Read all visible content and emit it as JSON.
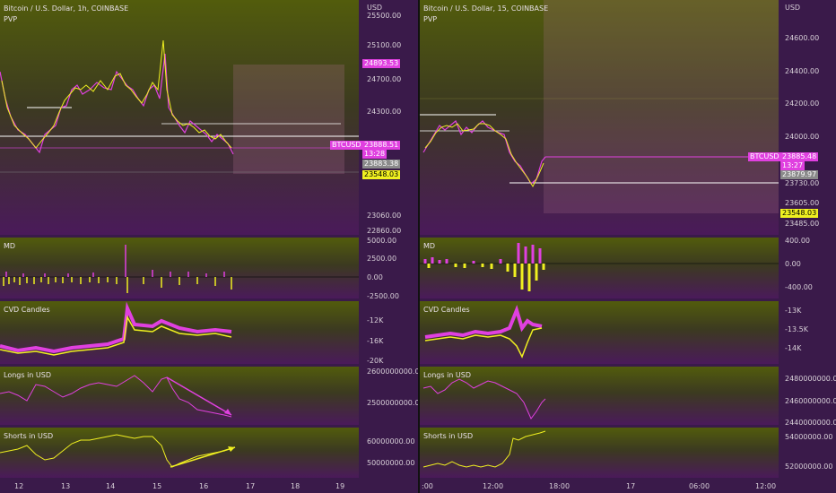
{
  "left": {
    "header": {
      "symbol": "Bitcoin / U.S. Dollar, 1h, COINBASE",
      "indicator": "PVP"
    },
    "unit": "USD",
    "price_ticks": [
      "25500.00",
      "25100.00",
      "24700.00",
      "24300.00",
      "23888.51",
      "23060.00",
      "22860.00"
    ],
    "price_tags": {
      "high": "24893.53",
      "symbol": "BTCUSD",
      "last": "23888.51",
      "countdown": "13:28",
      "gray": "23883.38",
      "yellow": "23548.03"
    },
    "md": {
      "title": "MD",
      "ticks": [
        "5000.00",
        "2500.00",
        "0.00",
        "-2500.00"
      ]
    },
    "cvd": {
      "title": "CVD Candles",
      "ticks": [
        "-12K",
        "-16K",
        "-20K"
      ]
    },
    "longs": {
      "title": "Longs in USD",
      "ticks": [
        "2600000000.00",
        "2500000000.00"
      ]
    },
    "shorts": {
      "title": "Shorts in USD",
      "ticks": [
        "60000000.00",
        "50000000.00"
      ]
    },
    "x_ticks": [
      "12",
      "13",
      "14",
      "15",
      "16",
      "17",
      "18",
      "19"
    ]
  },
  "right": {
    "header": {
      "symbol": "Bitcoin / U.S. Dollar, 15, COINBASE",
      "indicator": "PVP"
    },
    "unit": "USD",
    "price_ticks": [
      "24600.00",
      "24400.00",
      "24200.00",
      "24000.00",
      "23730.00",
      "23605.00",
      "23485.00"
    ],
    "price_tags": {
      "symbol": "BTCUSD",
      "last": "23885.48",
      "countdown": "13:27",
      "gray": "23879.97",
      "yellow": "23548.03"
    },
    "md": {
      "title": "MD",
      "ticks": [
        "400.00",
        "0.00",
        "-400.00"
      ]
    },
    "cvd": {
      "title": "CVD Candles",
      "ticks": [
        "-13K",
        "-13.5K",
        "-14K"
      ]
    },
    "longs": {
      "title": "Longs in USD",
      "ticks": [
        "2480000000.00",
        "2460000000.00",
        "2440000000.00"
      ]
    },
    "shorts": {
      "title": "Shorts in USD",
      "ticks": [
        "54000000.00",
        "52000000.00"
      ]
    },
    "x_ticks": [
      ":00",
      "12:00",
      "18:00",
      "17",
      "06:00",
      "12:00"
    ]
  },
  "colors": {
    "magenta": "#e040e0",
    "yellow": "#f0f020",
    "gray": "#8a8a8a",
    "white": "#ffffff"
  }
}
